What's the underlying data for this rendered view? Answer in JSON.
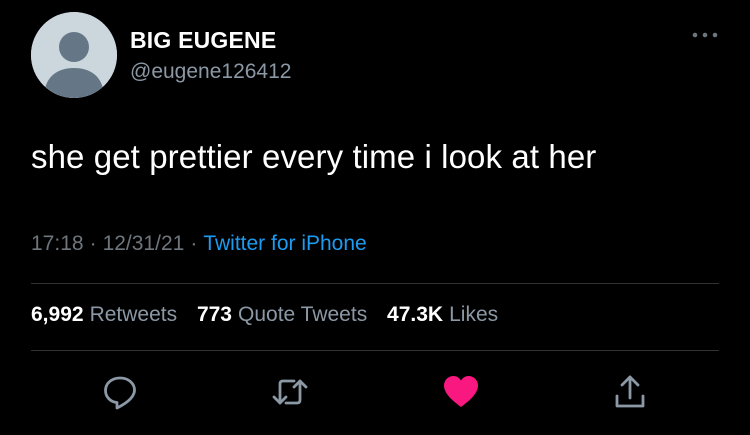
{
  "user": {
    "display_name": "BIG EUGENE",
    "handle": "@eugene126412"
  },
  "tweet": {
    "text": "she get prettier every time i look at her",
    "time": "17:18",
    "date": "12/31/21",
    "separator": "·",
    "source": "Twitter for iPhone"
  },
  "stats": {
    "retweets": {
      "count": "6,992",
      "label": "Retweets"
    },
    "quotes": {
      "count": "773",
      "label": "Quote Tweets"
    },
    "likes": {
      "count": "47.3K",
      "label": "Likes"
    }
  },
  "actions": {
    "reply_icon": "reply-icon",
    "retweet_icon": "retweet-icon",
    "like_icon": "heart-icon",
    "share_icon": "share-icon"
  },
  "colors": {
    "background": "#000000",
    "link": "#1d9bf0",
    "liked": "#f91880",
    "muted": "#6e767d"
  }
}
